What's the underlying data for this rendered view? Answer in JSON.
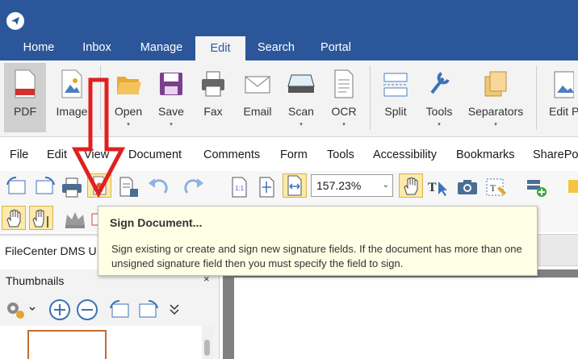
{
  "tabs": [
    "Home",
    "Inbox",
    "Manage",
    "Edit",
    "Search",
    "Portal"
  ],
  "active_tab": "Edit",
  "ribbon": {
    "pdf": "PDF",
    "image": "Image",
    "open": "Open",
    "save": "Save",
    "fax": "Fax",
    "email": "Email",
    "scan": "Scan",
    "ocr": "OCR",
    "split": "Split",
    "tools": "Tools",
    "separators": "Separators",
    "edit_p": "Edit P",
    "dropdown_glyph": "▾"
  },
  "menu": [
    "File",
    "Edit",
    "View",
    "Document",
    "Comments",
    "Form",
    "Tools",
    "Accessibility",
    "Bookmarks",
    "SharePo"
  ],
  "zoom": {
    "value": "157.23%",
    "arrow": "⌄"
  },
  "doc_tab": "FileCenter DMS U",
  "panel": {
    "title": "Thumbnails",
    "close": "×"
  },
  "tooltip": {
    "title": "Sign Document...",
    "body": "Sign existing or create and sign new signature fields. If the document has more than one unsigned signature field then you must specify the field to sign."
  },
  "colors": {
    "brand": "#2b579a",
    "highlight": "#fde9a8",
    "arrow": "#e02020",
    "tooltip_bg": "#ffffe6"
  },
  "icons": [
    "app-logo-icon",
    "pdf-icon",
    "image-icon",
    "folder-open-icon",
    "save-disk-icon",
    "fax-printer-icon",
    "email-envelope-icon",
    "scanner-icon",
    "ocr-document-icon",
    "split-icon",
    "wrench-tools-icon",
    "separators-icon",
    "rotate-left-icon",
    "rotate-right-icon",
    "print-icon",
    "sign-document-icon",
    "extract-icon",
    "undo-icon",
    "redo-icon",
    "actual-size-icon",
    "fit-page-icon",
    "fit-width-icon",
    "hand-tool-icon",
    "text-select-icon",
    "snapshot-camera-icon",
    "form-field-icon",
    "add-comment-icon",
    "crown-icon",
    "gear-icon",
    "zoom-in-icon",
    "zoom-out-icon",
    "more-icon"
  ]
}
